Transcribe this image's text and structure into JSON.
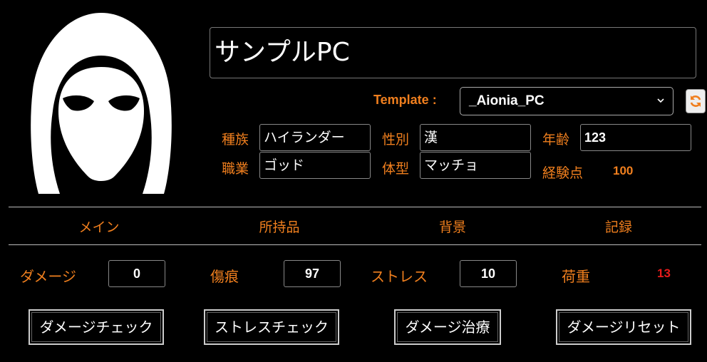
{
  "character": {
    "name": "サンプルPC"
  },
  "template": {
    "label": "Template :",
    "selected": "_Aionia_PC"
  },
  "fields": {
    "race_label": "種族",
    "race": "ハイランダー",
    "sex_label": "性別",
    "sex": "漢",
    "age_label": "年齢",
    "age": "123",
    "job_label": "職業",
    "job": "ゴッド",
    "body_label": "体型",
    "body": "マッチョ",
    "exp_label": "経験点",
    "exp": "100"
  },
  "tabs": [
    "メイン",
    "所持品",
    "背景",
    "記録"
  ],
  "stats": {
    "damage_label": "ダメージ",
    "damage": "0",
    "wound_label": "傷痕",
    "wound": "97",
    "stress_label": "ストレス",
    "stress": "10",
    "load_label": "荷重",
    "load": "13"
  },
  "actions": [
    "ダメージチェック",
    "ストレスチェック",
    "ダメージ治療",
    "ダメージリセット"
  ],
  "icons": {
    "avatar": "hooded-figure-icon",
    "refresh": "refresh-icon",
    "dropdown": "chevron-down-icon"
  },
  "colors": {
    "accent": "#f07f1e",
    "alert": "#e81b1b",
    "background": "#000000"
  }
}
